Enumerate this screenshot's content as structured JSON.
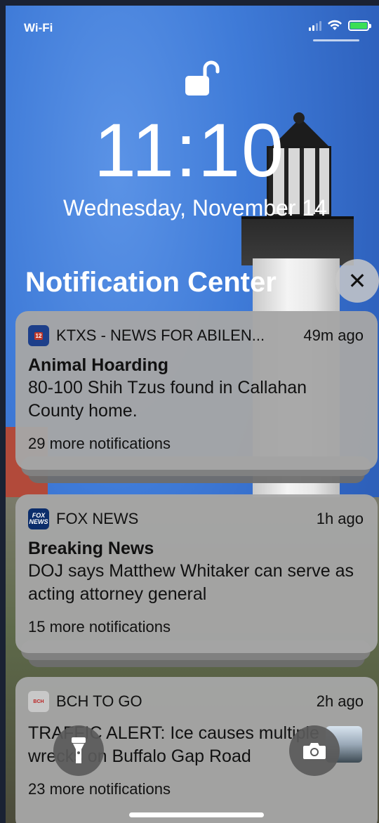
{
  "status_bar": {
    "carrier": "Wi-Fi"
  },
  "lock_screen": {
    "time": "11:10",
    "date": "Wednesday, November 14"
  },
  "notification_center": {
    "title": "Notification Center",
    "close_symbol": "✕"
  },
  "notifications": [
    {
      "app_name": "KTXS - NEWS FOR ABILEN...",
      "time_ago": "49m ago",
      "title": "Animal Hoarding",
      "body": "80-100 Shih Tzus found in Callahan County home.",
      "more": "29 more notifications",
      "icon": "ktxs-app-icon",
      "icon_color": "#1d3f8a"
    },
    {
      "app_name": "FOX NEWS",
      "time_ago": "1h ago",
      "title": "Breaking News",
      "body": "DOJ says Matthew Whitaker can serve as acting attorney general",
      "more": "15 more notifications",
      "icon": "fox-news-app-icon",
      "icon_color": "#0b2d6b"
    },
    {
      "app_name": "BCH TO GO",
      "time_ago": "2h ago",
      "title": "",
      "body": "TRAFFIC ALERT: Ice causes multiple wrecks on Buffalo Gap Road",
      "more": "23 more notifications",
      "icon": "bch-to-go-app-icon",
      "icon_color": "#c8c8c8"
    }
  ],
  "bottom_controls": {
    "flashlight": "flashlight-icon",
    "camera": "camera-icon"
  }
}
